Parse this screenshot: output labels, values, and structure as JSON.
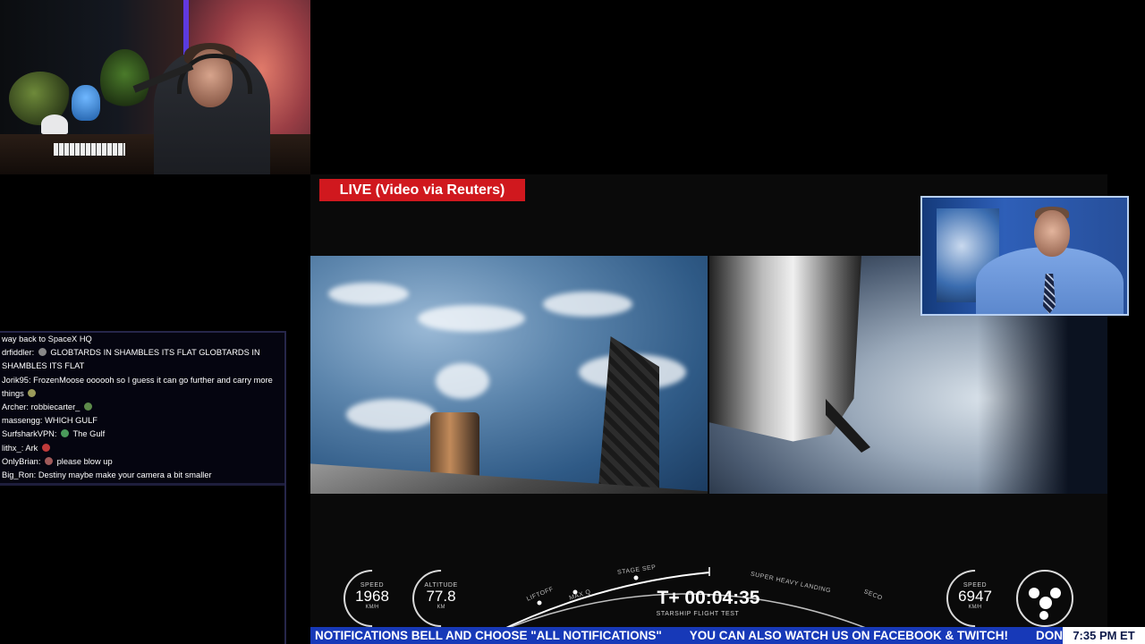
{
  "live_badge": "LIVE (Video via Reuters)",
  "chat": {
    "messages": [
      {
        "user": "",
        "text": "way back to SpaceX HQ"
      },
      {
        "user": "drfiddler:",
        "text": "GLOBTARDS IN SHAMBLES ITS FLAT GLOBTARDS IN SHAMBLES ITS FLAT"
      },
      {
        "user": "Jorik95:",
        "text": "FrozenMoose oooooh so I guess it can go further and carry more things"
      },
      {
        "user": "Archer:",
        "text": "robbiecarter_"
      },
      {
        "user": "massengg:",
        "text": "WHICH GULF"
      },
      {
        "user": "SurfsharkVPN:",
        "text": "The Gulf"
      },
      {
        "user": "lithx_:",
        "text": "Ark"
      },
      {
        "user": "OnlyBrian:",
        "text": "please blow up"
      },
      {
        "user": "Big_Ron:",
        "text": "Destiny maybe make your camera a bit smaller"
      }
    ]
  },
  "telemetry": {
    "booster": {
      "speed_label": "SPEED",
      "speed": "1968",
      "speed_unit": "KM/H",
      "altitude_label": "ALTITUDE",
      "altitude": "77.8",
      "altitude_unit": "KM"
    },
    "ship": {
      "speed_label": "SPEED",
      "speed": "6947",
      "speed_unit": "KM/H"
    },
    "timeline_labels": {
      "liftoff": "LIFTOFF",
      "max_q": "MAX Q",
      "stage_sep": "STAGE SEP",
      "landing": "SUPER HEAVY LANDING",
      "seco": "SECO"
    },
    "timer": "T+ 00:04:35",
    "mission": "STARSHIP FLIGHT TEST"
  },
  "ticker": {
    "items": [
      "NOTIFICATIONS BELL AND CHOOSE \"ALL NOTIFICATIONS\"",
      "YOU CAN ALSO WATCH US ON FACEBOOK & TWITCH!",
      "DON'T WAN"
    ],
    "clock": "7:35 PM ET"
  },
  "colors": {
    "live_red": "#d0181e",
    "ticker_blue": "#1739b8",
    "chat_border": "#26264a"
  }
}
